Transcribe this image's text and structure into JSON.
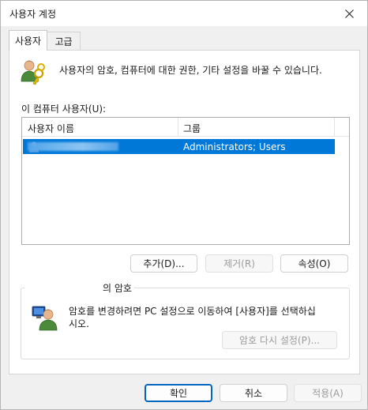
{
  "window": {
    "title": "사용자 계정"
  },
  "tabs": [
    {
      "label": "사용자",
      "active": true
    },
    {
      "label": "고급",
      "active": false
    }
  ],
  "users_tab": {
    "intro": "사용자의 암호, 컴퓨터에 대한 권한, 기타 설정을 바꿀 수 있습니다.",
    "list_label": "이 컴퓨터 사용자(U):",
    "columns": [
      "사용자 이름",
      "그룹"
    ],
    "rows": [
      {
        "name": "",
        "group": "Administrators; Users",
        "selected": true
      }
    ],
    "buttons": {
      "add": "추가(D)...",
      "remove": "제거(R)",
      "properties": "속성(O)"
    },
    "password_group": {
      "title": "의 암호",
      "message": "암호를 변경하려면 PC 설정으로 이동하여 [사용자]를 선택하십시오.",
      "message_line1": "암호를 변경하려면 PC 설정으로 이동하여 [사용자]를 선택하십",
      "message_line2": "시오.",
      "reset_button": "암호 다시 설정(P)..."
    }
  },
  "footer": {
    "ok": "확인",
    "cancel": "취소",
    "apply": "적용(A)"
  },
  "colors": {
    "selection": "#0078d7",
    "primary_border": "#0067c0",
    "disabled_text": "#9b9b9b"
  }
}
